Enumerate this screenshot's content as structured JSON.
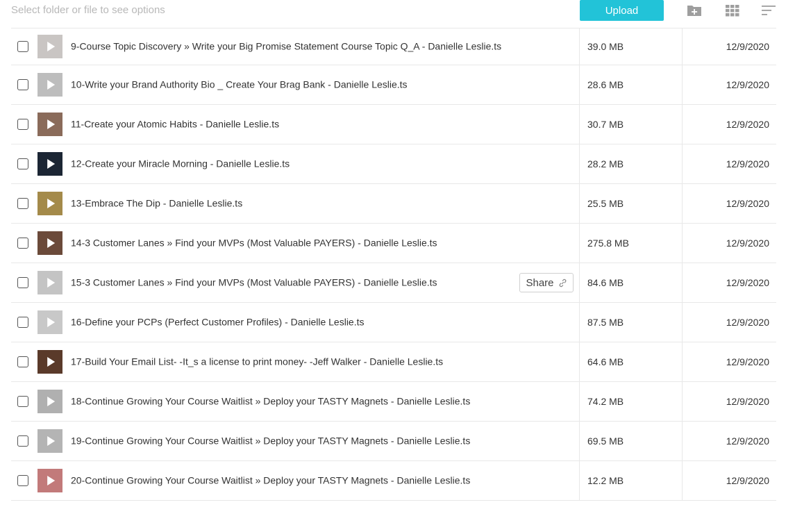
{
  "toolbar": {
    "hint": "Select folder or file to see options",
    "upload_label": "Upload",
    "icons": [
      "new-folder-icon",
      "grid-view-icon",
      "sort-icon"
    ]
  },
  "share_label": "Share",
  "colors": {
    "accent": "#22c3d8",
    "border": "#e8e8e8"
  },
  "files": [
    {
      "name": "9-Course Topic Discovery » Write your Big Promise Statement Course Topic Q_A - Danielle Leslie.ts",
      "size": "39.0 MB",
      "date": "12/9/2020",
      "thumb": "#c9c5c3"
    },
    {
      "name": "10-Write your Brand Authority Bio _ Create Your Brag Bank - Danielle Leslie.ts",
      "size": "28.6 MB",
      "date": "12/9/2020",
      "thumb": "#bdbdbd"
    },
    {
      "name": "11-Create your Atomic Habits - Danielle Leslie.ts",
      "size": "30.7 MB",
      "date": "12/9/2020",
      "thumb": "#8a6b5a"
    },
    {
      "name": "12-Create your Miracle Morning - Danielle Leslie.ts",
      "size": "28.2 MB",
      "date": "12/9/2020",
      "thumb": "#1c2634"
    },
    {
      "name": "13-Embrace The Dip - Danielle Leslie.ts",
      "size": "25.5 MB",
      "date": "12/9/2020",
      "thumb": "#a48a4a"
    },
    {
      "name": "14-3 Customer Lanes » Find your MVPs (Most Valuable PAYERS) - Danielle Leslie.ts",
      "size": "275.8 MB",
      "date": "12/9/2020",
      "thumb": "#6b4a3a"
    },
    {
      "name": "15-3 Customer Lanes » Find your MVPs (Most Valuable PAYERS) - Danielle Leslie.ts",
      "size": "84.6 MB",
      "date": "12/9/2020",
      "thumb": "#c4c4c4",
      "share": true
    },
    {
      "name": "16-Define your PCPs (Perfect Customer Profiles) - Danielle Leslie.ts",
      "size": "87.5 MB",
      "date": "12/9/2020",
      "thumb": "#c8c8c8"
    },
    {
      "name": "17-Build Your Email List- -It_s a license to print money- -Jeff Walker - Danielle Leslie.ts",
      "size": "64.6 MB",
      "date": "12/9/2020",
      "thumb": "#5a3a2a"
    },
    {
      "name": "18-Continue Growing Your Course Waitlist » Deploy your TASTY Magnets - Danielle Leslie.ts",
      "size": "74.2 MB",
      "date": "12/9/2020",
      "thumb": "#b0b0b0"
    },
    {
      "name": "19-Continue Growing Your Course Waitlist » Deploy your TASTY Magnets - Danielle Leslie.ts",
      "size": "69.5 MB",
      "date": "12/9/2020",
      "thumb": "#b4b4b4"
    },
    {
      "name": "20-Continue Growing Your Course Waitlist » Deploy your TASTY Magnets - Danielle Leslie.ts",
      "size": "12.2 MB",
      "date": "12/9/2020",
      "thumb": "#c27a7a"
    }
  ]
}
